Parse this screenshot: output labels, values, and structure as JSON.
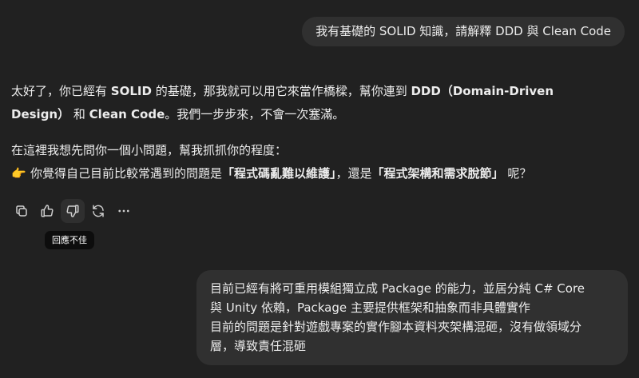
{
  "conversation": {
    "user_message_1": "我有基礎的 SOLID 知識，請解釋 DDD 與 Clean Code",
    "assistant": {
      "p1_line1": {
        "a": "太好了，你已經有 ",
        "b": "SOLID",
        "c": " 的基礎，那我就可以用它來當作橋樑，幫你連到 ",
        "d": "DDD（Domain-Driven"
      },
      "p1_line2": {
        "a": "Design）",
        "b": " 和 ",
        "c": "Clean Code",
        "d": "。我們一步步來，不會一次塞滿。"
      },
      "p2_line1": "在這裡我想先問你一個小問題，幫我抓抓你的程度：",
      "p2_line2": {
        "emoji": "👉",
        "a": "你覺得自己目前比較常遇到的問題是",
        "b": "「程式碼亂難以維護」",
        "c": "，還是",
        "d": "「程式架構和需求脫節」",
        "e": " 呢？"
      }
    },
    "actions": {
      "copy": "copy-icon",
      "like": "thumbs-up-icon",
      "dislike": "thumbs-down-icon",
      "regenerate": "refresh-icon",
      "more": "more-icon"
    },
    "tooltip": "回應不佳",
    "user_message_2": {
      "line1": "目前已經有將可重用模組獨立成 Package 的能力，並居分純 C# Core",
      "line2": "與 Unity 依賴，Package 主要提供框架和抽象而非具體實作",
      "line3": "目前的問題是針對遊戲專案的實作腳本資料夾架構混砸，沒有做領域分",
      "line4": "層，導致責任混砸"
    }
  }
}
